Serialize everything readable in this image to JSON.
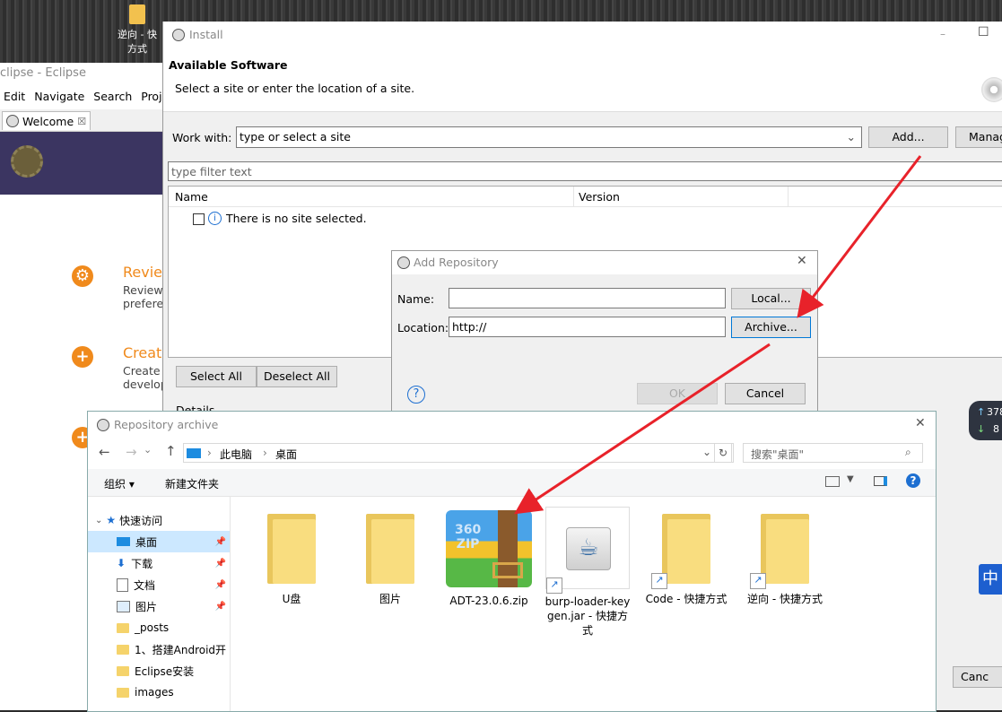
{
  "desktop": {
    "icon_label": "逆向 - 快",
    "icon_label2": "方式"
  },
  "eclipse": {
    "title": "clipse - Eclipse",
    "menu": [
      "Edit",
      "Navigate",
      "Search",
      "Proj"
    ],
    "tab_label": "Welcome",
    "review_title": "Revie",
    "review_sub1": "Review",
    "review_sub2": "prefere",
    "create_title": "Creat",
    "create_sub1": "Create",
    "create_sub2": "develop"
  },
  "install": {
    "window_title": "Install",
    "heading": "Available Software",
    "subheading": "Select a site or enter the location of a site.",
    "work_with_label": "Work with:",
    "work_with_value": "type or select a site",
    "add_button": "Add...",
    "manage_button": "Manag",
    "filter_placeholder": "type filter text",
    "col_name": "Name",
    "col_version": "Version",
    "empty_message": "There is no site selected.",
    "select_all": "Select All",
    "deselect_all": "Deselect All",
    "details": "Details",
    "cancel_partial": "Canc"
  },
  "add_repository": {
    "title": "Add Repository",
    "name_label": "Name:",
    "name_value": "",
    "location_label": "Location:",
    "location_value": "http://",
    "local_button": "Local...",
    "archive_button": "Archive...",
    "ok_button": "OK",
    "cancel_button": "Cancel",
    "help_icon": "?"
  },
  "archive": {
    "title": "Repository archive",
    "breadcrumb": [
      "此电脑",
      "桌面"
    ],
    "search_placeholder": "搜索\"桌面\"",
    "organize": "组织",
    "new_folder": "新建文件夹",
    "sidebar": [
      {
        "label": "快速访问",
        "pinned": false
      },
      {
        "label": "桌面",
        "pinned": true
      },
      {
        "label": "下载",
        "pinned": true
      },
      {
        "label": "文档",
        "pinned": true
      },
      {
        "label": "图片",
        "pinned": true
      },
      {
        "label": "_posts",
        "pinned": false
      },
      {
        "label": "1、搭建Android开",
        "pinned": false
      },
      {
        "label": "Eclipse安装",
        "pinned": false
      },
      {
        "label": "images",
        "pinned": false
      }
    ],
    "files": [
      {
        "label": "U盘",
        "type": "folder"
      },
      {
        "label": "图片",
        "type": "folder"
      },
      {
        "label": "ADT-23.0.6.zip",
        "type": "zip"
      },
      {
        "label": "burp-loader-keygen.jar - 快捷方式",
        "type": "jar"
      },
      {
        "label": "Code - 快捷方式",
        "type": "folder-shortcut"
      },
      {
        "label": "逆向 - 快捷方式",
        "type": "folder-shortcut"
      }
    ]
  },
  "tray": {
    "up": "378",
    "down": "8",
    "ime": "中"
  },
  "colors": {
    "arrow": "#e8222a",
    "accent": "#f08a1c",
    "selection": "#cce8ff"
  }
}
